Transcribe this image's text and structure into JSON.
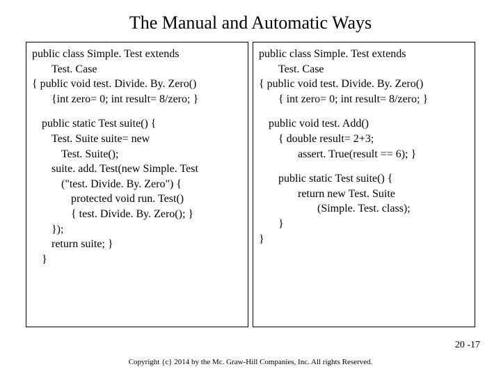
{
  "title": "The Manual and Automatic Ways",
  "left": {
    "l1": "public class Simple. Test extends",
    "l1b": "Test. Case",
    "l2": "{  public void test. Divide. By. Zero()",
    "l3": "{int zero= 0; int result= 8/zero; }",
    "l4": "public static Test suite() {",
    "l5": "Test. Suite suite= new",
    "l5b": "Test. Suite();",
    "l6": "suite. add. Test(new Simple. Test",
    "l6b": "(\"test. Divide. By. Zero\") {",
    "l7": "protected void run. Test()",
    "l8": "{ test. Divide. By. Zero(); }",
    "l9": "});",
    "l10": "return suite; }",
    "l11": "}"
  },
  "right": {
    "r1": "public class Simple. Test extends",
    "r1b": "Test. Case",
    "r2": "{  public void test. Divide. By. Zero()",
    "r3": "{ int zero= 0; int result= 8/zero; }",
    "r4": "public void test. Add()",
    "r5": "{   double result= 2+3;",
    "r6": "assert. True(result == 6); }",
    "r7": "public static Test suite() {",
    "r8": "return new Test. Suite",
    "r9": "(Simple. Test. class);",
    "r10": "}",
    "r11": "}"
  },
  "slidenum": "20 -17",
  "copyright": "Copyright {c} 2014 by the Mc. Graw-Hill Companies, Inc.  All rights Reserved."
}
